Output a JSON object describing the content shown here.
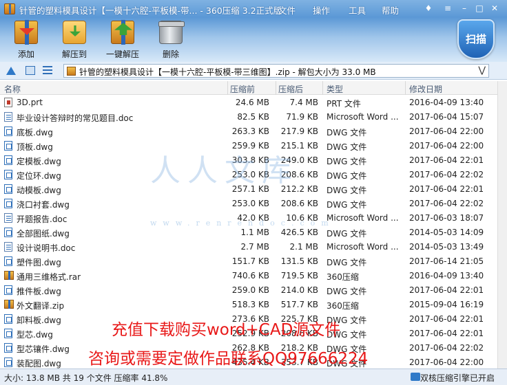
{
  "window": {
    "title": "针管的塑料模具设计【一模十六腔-平板模-带... - 360压缩 3.2正式版",
    "menus": [
      "文件",
      "操作",
      "工具",
      "帮助"
    ]
  },
  "toolbar": {
    "add": "添加",
    "extract": "解压到",
    "one_click": "一键解压",
    "delete": "删除",
    "scan": "扫描"
  },
  "address": {
    "path": "针管的塑料模具设计【一模十六腔-平板模-带三维图】.zip - 解包大小为 33.0 MB"
  },
  "columns": {
    "name": "名称",
    "size": "压缩前",
    "csize": "压缩后",
    "type": "类型",
    "date": "修改日期"
  },
  "files": [
    {
      "icon": "prt",
      "name": "3D.prt",
      "size": "24.6 MB",
      "csize": "7.4 MB",
      "type": "PRT 文件",
      "date": "2016-04-09 13:40"
    },
    {
      "icon": "doc",
      "name": "毕业设计答辩时的常见题目.doc",
      "size": "82.5 KB",
      "csize": "71.9 KB",
      "type": "Microsoft Word ...",
      "date": "2017-06-04 15:07"
    },
    {
      "icon": "dwg",
      "name": "底板.dwg",
      "size": "263.3 KB",
      "csize": "217.9 KB",
      "type": "DWG 文件",
      "date": "2017-06-04 22:00"
    },
    {
      "icon": "dwg",
      "name": "顶板.dwg",
      "size": "259.9 KB",
      "csize": "215.1 KB",
      "type": "DWG 文件",
      "date": "2017-06-04 22:00"
    },
    {
      "icon": "dwg",
      "name": "定模板.dwg",
      "size": "303.8 KB",
      "csize": "249.0 KB",
      "type": "DWG 文件",
      "date": "2017-06-04 22:01"
    },
    {
      "icon": "dwg",
      "name": "定位环.dwg",
      "size": "253.0 KB",
      "csize": "208.6 KB",
      "type": "DWG 文件",
      "date": "2017-06-04 22:02"
    },
    {
      "icon": "dwg",
      "name": "动模板.dwg",
      "size": "257.1 KB",
      "csize": "212.2 KB",
      "type": "DWG 文件",
      "date": "2017-06-04 22:01"
    },
    {
      "icon": "dwg",
      "name": "浇口衬套.dwg",
      "size": "253.0 KB",
      "csize": "208.6 KB",
      "type": "DWG 文件",
      "date": "2017-06-04 22:02"
    },
    {
      "icon": "doc",
      "name": "开题报告.doc",
      "size": "42.0 KB",
      "csize": "10.6 KB",
      "type": "Microsoft Word ...",
      "date": "2017-06-03 18:07"
    },
    {
      "icon": "dwg",
      "name": "全部图纸.dwg",
      "size": "1.1 MB",
      "csize": "426.5 KB",
      "type": "DWG 文件",
      "date": "2014-05-03 14:09"
    },
    {
      "icon": "doc",
      "name": "设计说明书.doc",
      "size": "2.7 MB",
      "csize": "2.1 MB",
      "type": "Microsoft Word ...",
      "date": "2014-05-03 13:49"
    },
    {
      "icon": "dwg",
      "name": "塑件图.dwg",
      "size": "151.7 KB",
      "csize": "131.5 KB",
      "type": "DWG 文件",
      "date": "2017-06-14 21:05"
    },
    {
      "icon": "arc",
      "name": "通用三维格式.rar",
      "size": "740.6 KB",
      "csize": "719.5 KB",
      "type": "360压缩",
      "date": "2016-04-09 13:40"
    },
    {
      "icon": "dwg",
      "name": "推件板.dwg",
      "size": "259.0 KB",
      "csize": "214.0 KB",
      "type": "DWG 文件",
      "date": "2017-06-04 22:01"
    },
    {
      "icon": "arc",
      "name": "外文翻译.zip",
      "size": "518.3 KB",
      "csize": "517.7 KB",
      "type": "360压缩",
      "date": "2015-09-04 16:19"
    },
    {
      "icon": "dwg",
      "name": "卸料板.dwg",
      "size": "273.6 KB",
      "csize": "225.7 KB",
      "type": "DWG 文件",
      "date": "2017-06-04 22:01"
    },
    {
      "icon": "dwg",
      "name": "型芯.dwg",
      "size": "252.9 KB",
      "csize": "208.6 KB",
      "type": "DWG 文件",
      "date": "2017-06-04 22:01"
    },
    {
      "icon": "dwg",
      "name": "型芯镶件.dwg",
      "size": "262.8 KB",
      "csize": "218.2 KB",
      "type": "DWG 文件",
      "date": "2017-06-04 22:02"
    },
    {
      "icon": "dwg",
      "name": "装配图.dwg",
      "size": "435.4 KB",
      "csize": "353.7 KB",
      "type": "DWG 文件",
      "date": "2017-06-04 22:00"
    }
  ],
  "watermark": {
    "text": "人人文库",
    "url": "www.renrendoc.com"
  },
  "promo": {
    "line1": "充值下载购买word+CAD源文件",
    "line2": "咨询或需要定做作品联系QQ97666224"
  },
  "status": {
    "left": "大小: 13.8 MB 共 19 个文件 压缩率 41.8%",
    "right": "双核压缩引擎已开启"
  },
  "icons": {
    "up": "up-arrow-icon",
    "view_large": "large-view-icon",
    "view_list": "list-view-icon"
  }
}
